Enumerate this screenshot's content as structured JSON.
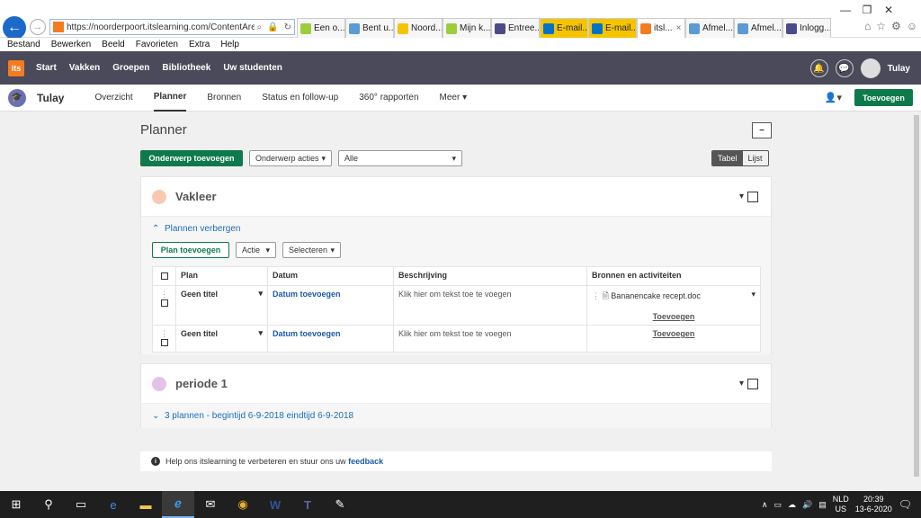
{
  "browser": {
    "url": "https://noorderpoort.itslearning.com/ContentArea...",
    "tabs": [
      {
        "label": "Een o...",
        "color": "#9ecc3a",
        "style": "normal"
      },
      {
        "label": "Bent u...",
        "color": "#5b9bd5",
        "style": "normal"
      },
      {
        "label": "Noord...",
        "color": "#f5c400",
        "style": "normal"
      },
      {
        "label": "Mijn k...",
        "color": "#9ecc3a",
        "style": "normal"
      },
      {
        "label": "Entree...",
        "color": "#4a4a8a",
        "style": "normal"
      },
      {
        "label": "E-mail...",
        "color": "#0072c6",
        "style": "yellow"
      },
      {
        "label": "E-mail...",
        "color": "#0072c6",
        "style": "yellow"
      },
      {
        "label": "itsl...",
        "color": "#f47b20",
        "style": "active"
      },
      {
        "label": "Afmel...",
        "color": "#5b9bd5",
        "style": "normal"
      },
      {
        "label": "Afmel...",
        "color": "#5b9bd5",
        "style": "normal"
      },
      {
        "label": "Inlogg...",
        "color": "#4a4a8a",
        "style": "normal"
      }
    ],
    "menu": [
      "Bestand",
      "Bewerken",
      "Beeld",
      "Favorieten",
      "Extra",
      "Help"
    ]
  },
  "topnav": {
    "logo": "its",
    "items": [
      "Start",
      "Vakken",
      "Groepen",
      "Bibliotheek",
      "Uw studenten"
    ],
    "user": "Tulay"
  },
  "course": {
    "name": "Tulay",
    "tabs": [
      "Overzicht",
      "Planner",
      "Bronnen",
      "Status en follow-up",
      "360° rapporten",
      "Meer"
    ],
    "active_tab": "Planner",
    "add_button": "Toevoegen"
  },
  "planner": {
    "title": "Planner",
    "add_topic": "Onderwerp toevoegen",
    "topic_actions": "Onderwerp acties",
    "filter": "Alle",
    "view_table": "Tabel",
    "view_list": "Lijst",
    "sections": [
      {
        "title": "Vakleer",
        "dot_color": "#f8c9b0",
        "toggle": "Plannen verbergen",
        "plan_add": "Plan toevoegen",
        "action": "Actie",
        "select": "Selecteren",
        "columns": [
          "Plan",
          "Datum",
          "Beschrijving",
          "Bronnen en activiteiten"
        ],
        "rows": [
          {
            "plan": "Geen titel",
            "date": "Datum toevoegen",
            "desc": "Klik hier om tekst toe te voegen",
            "resource": "Bananencake recept.doc",
            "add": "Toevoegen"
          },
          {
            "plan": "Geen titel",
            "date": "Datum toevoegen",
            "desc": "Klik hier om tekst toe te voegen",
            "resource": "",
            "add": "Toevoegen"
          }
        ]
      },
      {
        "title": "periode 1",
        "dot_color": "#e3c2e8",
        "summary": "3 plannen - begintijd 6-9-2018 eindtijd 6-9-2018"
      }
    ],
    "feedback_text": "Help ons itslearning te verbeteren en stuur ons uw",
    "feedback_link": "feedback"
  },
  "taskbar": {
    "lang": "NLD",
    "region": "US",
    "time": "20:39",
    "date": "13-6-2020"
  }
}
